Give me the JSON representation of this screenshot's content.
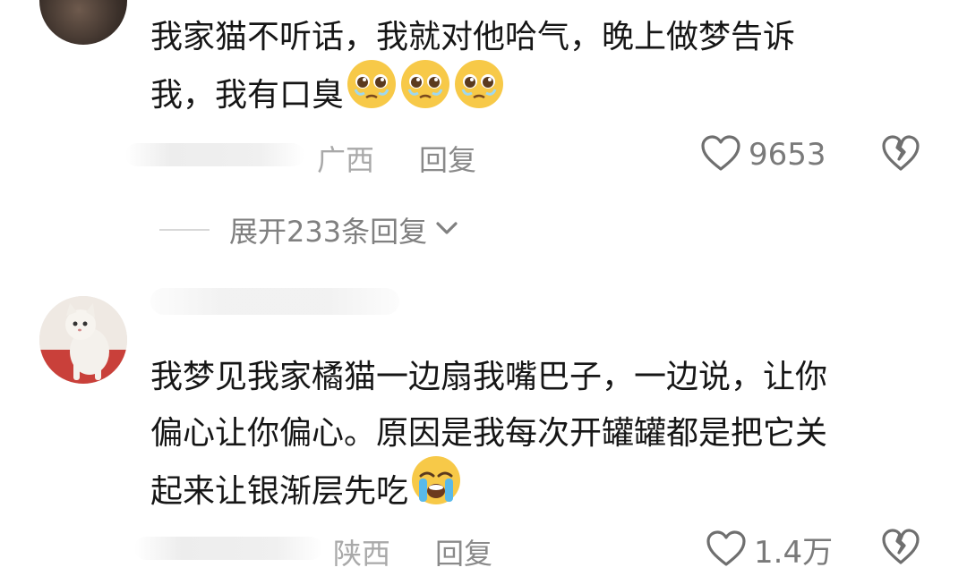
{
  "comments": [
    {
      "lines": [
        "我家猫不听话，我就对他哈气，晚上做梦告诉",
        "我，我有口臭"
      ],
      "trailing_emoji": [
        "pleading-face-emoji",
        "pleading-face-emoji",
        "pleading-face-emoji"
      ],
      "location": "广西",
      "reply_label": "回复",
      "like_count": "9653",
      "expand_replies_label": "展开233条回复"
    },
    {
      "lines": [
        "我梦见我家橘猫一边扇我嘴巴子，一边说，让你",
        "偏心让你偏心。原因是我每次开罐罐都是把它关",
        "起来让银渐层先吃"
      ],
      "trailing_emoji": [
        "loudly-crying-face-emoji"
      ],
      "location": "陕西",
      "reply_label": "回复",
      "like_count": "1.4万"
    }
  ],
  "icons": {
    "like": "heart-outline-icon",
    "dislike": "broken-heart-outline-icon",
    "expand": "chevron-down-icon"
  },
  "colors": {
    "text": "#161616",
    "meta": "#a9a9a9",
    "reply": "#8a8a8a",
    "emoji_yellow": "#f7c948"
  }
}
